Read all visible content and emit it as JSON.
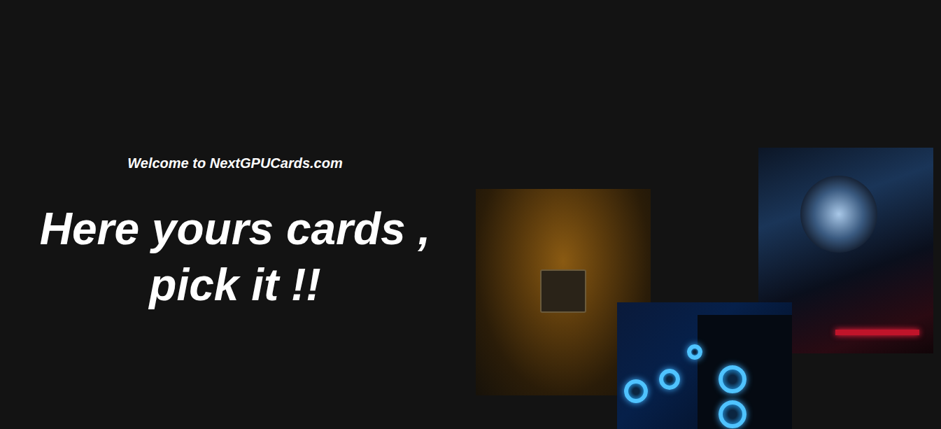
{
  "hero": {
    "welcome": "Welcome to NextGPUCards.com",
    "heading": "Here yours cards , pick it !!"
  }
}
